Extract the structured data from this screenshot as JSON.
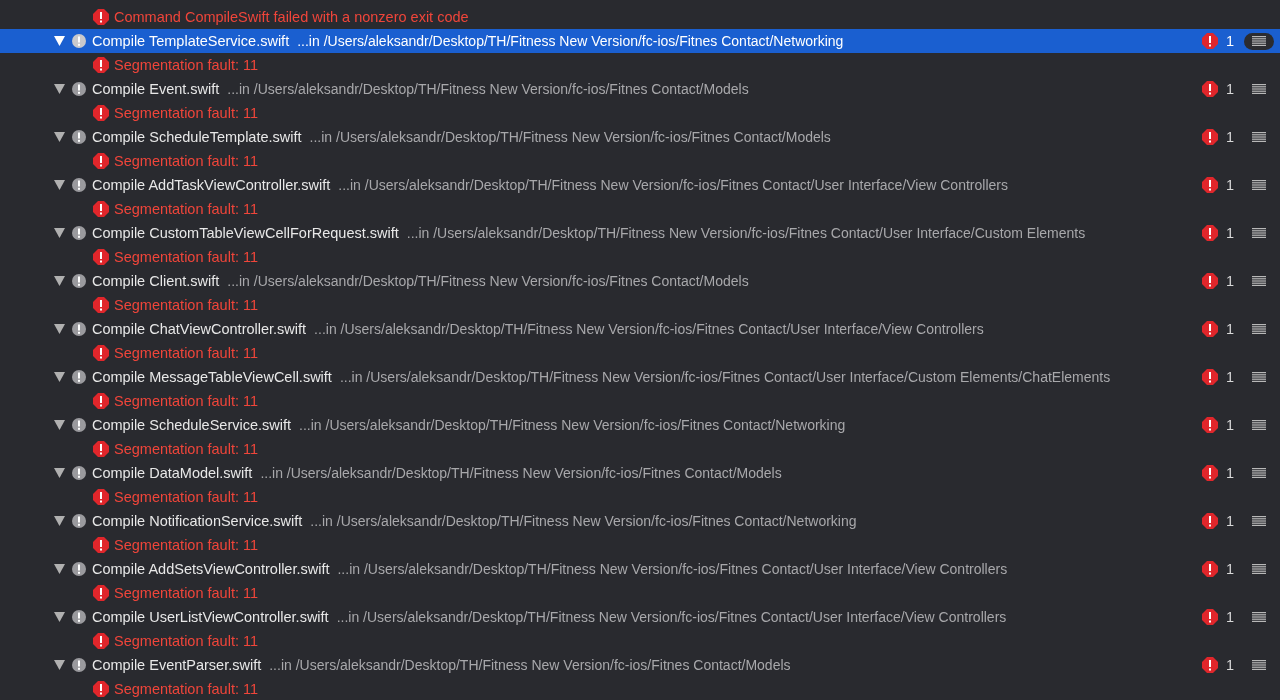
{
  "top_error": "Command CompileSwift failed with a nonzero exit code",
  "items": [
    {
      "title": "Compile TemplateService.swift",
      "path": "...in /Users/aleksandr/Desktop/TH/Fitness New Version/fc-ios/Fitnes Contact/Networking",
      "selected": true,
      "expanded": true,
      "count": "1",
      "errors": [
        "Segmentation fault: 11"
      ]
    },
    {
      "title": "Compile Event.swift",
      "path": "...in /Users/aleksandr/Desktop/TH/Fitness New Version/fc-ios/Fitnes Contact/Models",
      "selected": false,
      "expanded": true,
      "count": "1",
      "errors": [
        "Segmentation fault: 11"
      ]
    },
    {
      "title": "Compile ScheduleTemplate.swift",
      "path": "...in /Users/aleksandr/Desktop/TH/Fitness New Version/fc-ios/Fitnes Contact/Models",
      "selected": false,
      "expanded": true,
      "count": "1",
      "errors": [
        "Segmentation fault: 11"
      ]
    },
    {
      "title": "Compile AddTaskViewController.swift",
      "path": "...in /Users/aleksandr/Desktop/TH/Fitness New Version/fc-ios/Fitnes Contact/User Interface/View Controllers",
      "selected": false,
      "expanded": true,
      "count": "1",
      "errors": [
        "Segmentation fault: 11"
      ]
    },
    {
      "title": "Compile CustomTableViewCellForRequest.swift",
      "path": "...in /Users/aleksandr/Desktop/TH/Fitness New Version/fc-ios/Fitnes Contact/User Interface/Custom Elements",
      "selected": false,
      "expanded": true,
      "count": "1",
      "errors": [
        "Segmentation fault: 11"
      ]
    },
    {
      "title": "Compile Client.swift",
      "path": "...in /Users/aleksandr/Desktop/TH/Fitness New Version/fc-ios/Fitnes Contact/Models",
      "selected": false,
      "expanded": true,
      "count": "1",
      "errors": [
        "Segmentation fault: 11"
      ]
    },
    {
      "title": "Compile ChatViewController.swift",
      "path": "...in /Users/aleksandr/Desktop/TH/Fitness New Version/fc-ios/Fitnes Contact/User Interface/View Controllers",
      "selected": false,
      "expanded": true,
      "count": "1",
      "errors": [
        "Segmentation fault: 11"
      ]
    },
    {
      "title": "Compile MessageTableViewCell.swift",
      "path": "...in /Users/aleksandr/Desktop/TH/Fitness New Version/fc-ios/Fitnes Contact/User Interface/Custom Elements/ChatElements",
      "selected": false,
      "expanded": true,
      "count": "1",
      "errors": [
        "Segmentation fault: 11"
      ]
    },
    {
      "title": "Compile ScheduleService.swift",
      "path": "...in /Users/aleksandr/Desktop/TH/Fitness New Version/fc-ios/Fitnes Contact/Networking",
      "selected": false,
      "expanded": true,
      "count": "1",
      "errors": [
        "Segmentation fault: 11"
      ]
    },
    {
      "title": "Compile DataModel.swift",
      "path": "...in /Users/aleksandr/Desktop/TH/Fitness New Version/fc-ios/Fitnes Contact/Models",
      "selected": false,
      "expanded": true,
      "count": "1",
      "errors": [
        "Segmentation fault: 11"
      ]
    },
    {
      "title": "Compile NotificationService.swift",
      "path": "...in /Users/aleksandr/Desktop/TH/Fitness New Version/fc-ios/Fitnes Contact/Networking",
      "selected": false,
      "expanded": true,
      "count": "1",
      "errors": [
        "Segmentation fault: 11"
      ]
    },
    {
      "title": "Compile AddSetsViewController.swift",
      "path": "...in /Users/aleksandr/Desktop/TH/Fitness New Version/fc-ios/Fitnes Contact/User Interface/View Controllers",
      "selected": false,
      "expanded": true,
      "count": "1",
      "errors": [
        "Segmentation fault: 11"
      ]
    },
    {
      "title": "Compile UserListViewController.swift",
      "path": "...in /Users/aleksandr/Desktop/TH/Fitness New Version/fc-ios/Fitnes Contact/User Interface/View Controllers",
      "selected": false,
      "expanded": true,
      "count": "1",
      "errors": [
        "Segmentation fault: 11"
      ]
    },
    {
      "title": "Compile EventParser.swift",
      "path": "...in /Users/aleksandr/Desktop/TH/Fitness New Version/fc-ios/Fitnes Contact/Models",
      "selected": false,
      "expanded": true,
      "count": "1",
      "errors": [
        "Segmentation fault: 11"
      ]
    }
  ]
}
